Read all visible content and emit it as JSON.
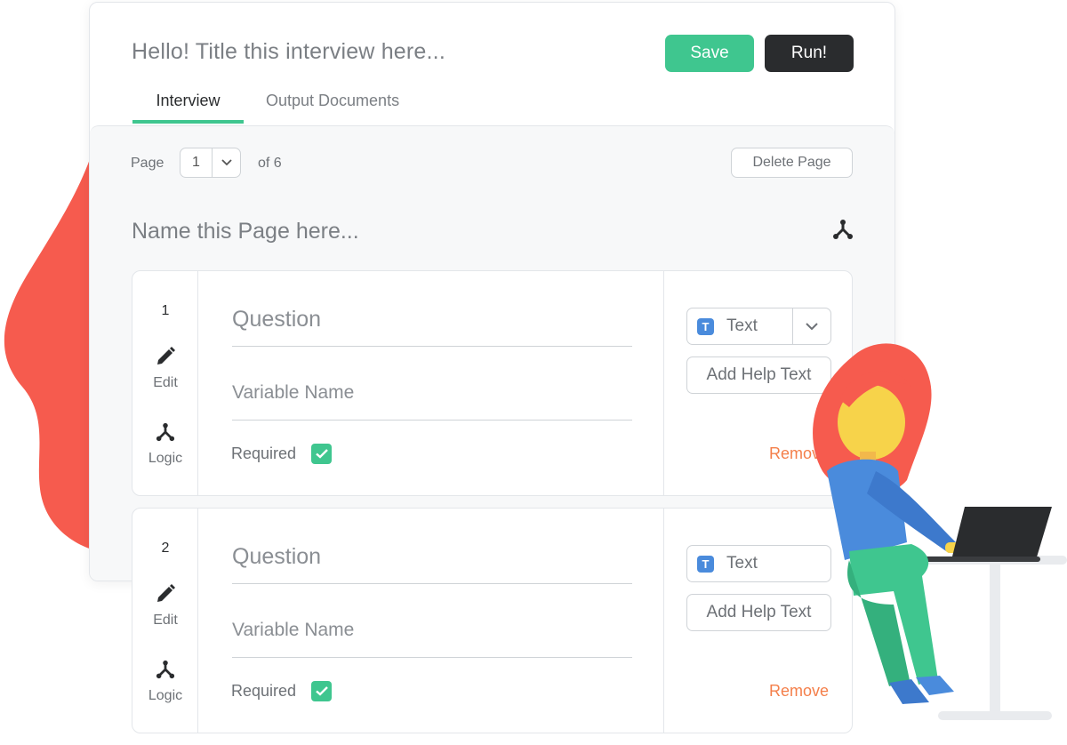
{
  "header": {
    "title_placeholder": "Hello! Title this interview here...",
    "save_label": "Save",
    "run_label": "Run!"
  },
  "tabs": [
    {
      "label": "Interview",
      "active": true
    },
    {
      "label": "Output Documents",
      "active": false
    }
  ],
  "page_controls": {
    "page_label": "Page",
    "current_page": "1",
    "of_label": "of 6",
    "delete_label": "Delete Page",
    "page_name_placeholder": "Name this Page here..."
  },
  "questions": [
    {
      "number": "1",
      "edit_label": "Edit",
      "logic_label": "Logic",
      "question_placeholder": "Question",
      "variable_placeholder": "Variable Name",
      "required_label": "Required",
      "required": true,
      "type_label": "Text",
      "type_icon": "T",
      "help_label": "Add Help Text",
      "remove_label": "Remove"
    },
    {
      "number": "2",
      "edit_label": "Edit",
      "logic_label": "Logic",
      "question_placeholder": "Question",
      "variable_placeholder": "Variable Name",
      "required_label": "Required",
      "required": true,
      "type_label": "Text",
      "type_icon": "T",
      "help_label": "Add Help Text",
      "remove_label": "Remove"
    }
  ],
  "colors": {
    "accent_green": "#3fc68f",
    "dark_button": "#2a2c2e",
    "remove_orange": "#f47f4a",
    "type_badge_blue": "#4a8bdc",
    "decor_red": "#f65b4e"
  }
}
